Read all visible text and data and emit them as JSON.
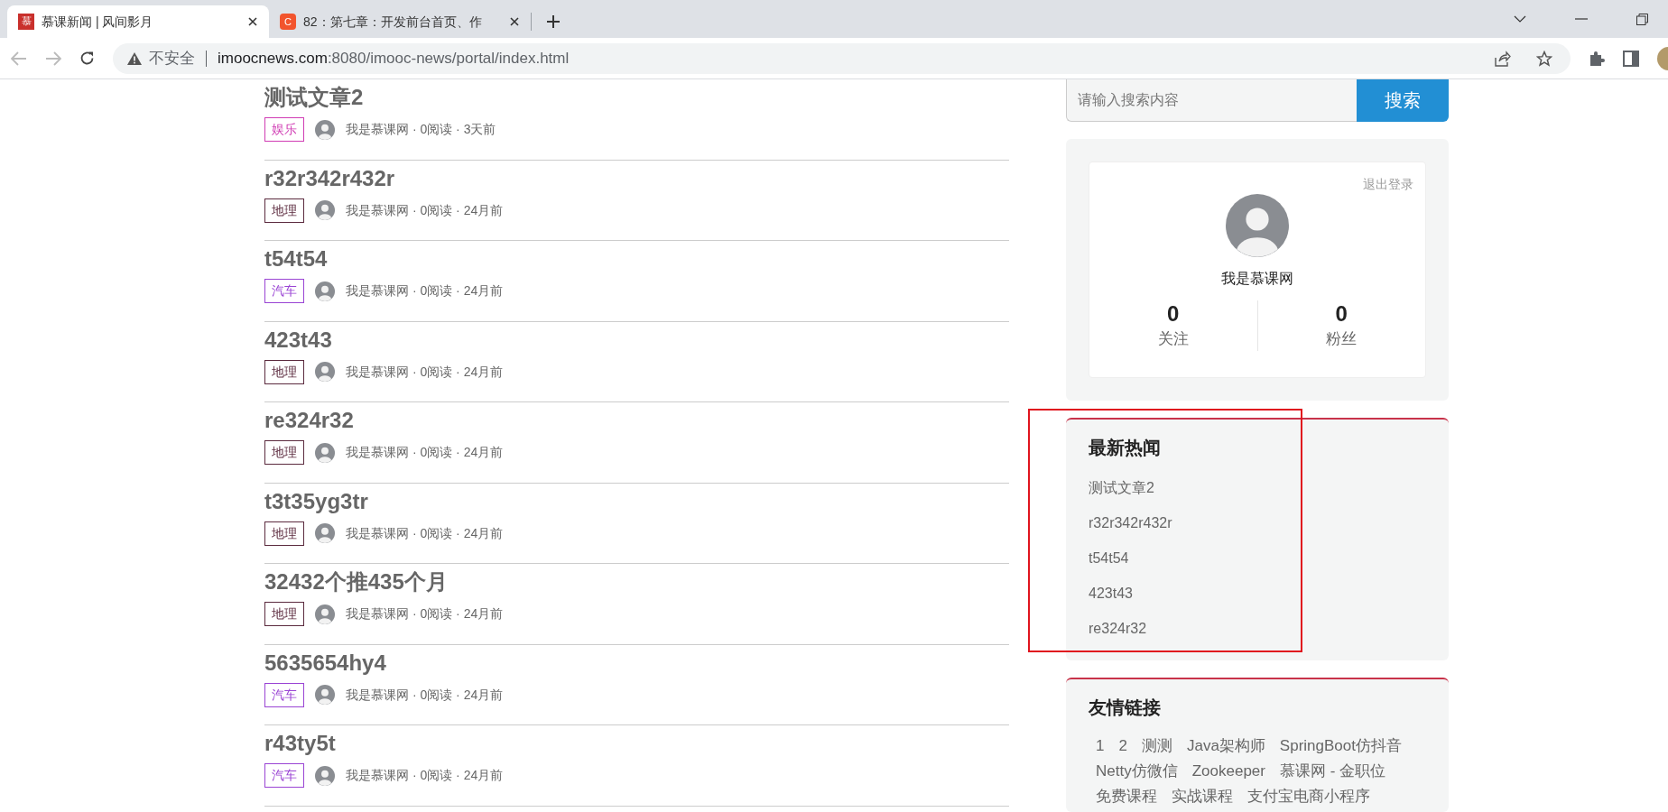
{
  "browser": {
    "tabs": [
      {
        "title": "慕课新闻 | 风间影月",
        "favicon": "慕",
        "selected": true
      },
      {
        "title": "82：第七章：开发前台首页、作",
        "favicon": "C",
        "selected": false
      }
    ],
    "security": "不安全",
    "url_host": "imoocnews.com",
    "url_path": ":8080/imooc-news/portal/index.html"
  },
  "articles": [
    {
      "title": "测试文章2",
      "tag": "娱乐",
      "color": "#d03cb4",
      "meta": "我是慕课网 · 0阅读 · 3天前"
    },
    {
      "title": "r32r342r432r",
      "tag": "地理",
      "color": "#5b2a3e",
      "meta": "我是慕课网 · 0阅读 · 24月前"
    },
    {
      "title": "t54t54",
      "tag": "汽车",
      "color": "#9a44d4",
      "meta": "我是慕课网 · 0阅读 · 24月前"
    },
    {
      "title": "423t43",
      "tag": "地理",
      "color": "#5b2a3e",
      "meta": "我是慕课网 · 0阅读 · 24月前"
    },
    {
      "title": "re324r32",
      "tag": "地理",
      "color": "#5b2a3e",
      "meta": "我是慕课网 · 0阅读 · 24月前"
    },
    {
      "title": "t3t35yg3tr",
      "tag": "地理",
      "color": "#5b2a3e",
      "meta": "我是慕课网 · 0阅读 · 24月前"
    },
    {
      "title": "32432个推435个月",
      "tag": "地理",
      "color": "#5b2a3e",
      "meta": "我是慕课网 · 0阅读 · 24月前"
    },
    {
      "title": "5635654hy4",
      "tag": "汽车",
      "color": "#9a44d4",
      "meta": "我是慕课网 · 0阅读 · 24月前"
    },
    {
      "title": "r43ty5t",
      "tag": "汽车",
      "color": "#9a44d4",
      "meta": "我是慕课网 · 0阅读 · 24月前"
    }
  ],
  "search": {
    "placeholder": "请输入搜索内容",
    "button": "搜索"
  },
  "profile": {
    "logout": "退出登录",
    "name": "我是慕课网",
    "stats": [
      {
        "value": "0",
        "label": "关注"
      },
      {
        "value": "0",
        "label": "粉丝"
      }
    ]
  },
  "hot_news": {
    "title": "最新热闻",
    "annotated": true,
    "items": [
      "测试文章2",
      "r32r342r432r",
      "t54t54",
      "423t43",
      "re324r32"
    ]
  },
  "friend_links": {
    "title": "友情链接",
    "links": [
      "1",
      "2",
      "测测",
      "Java架构师",
      "SpringBoot仿抖音",
      "Netty仿微信",
      "Zookeeper",
      "慕课网 - 金职位",
      "免费课程",
      "实战课程",
      "支付宝电商小程序"
    ]
  }
}
